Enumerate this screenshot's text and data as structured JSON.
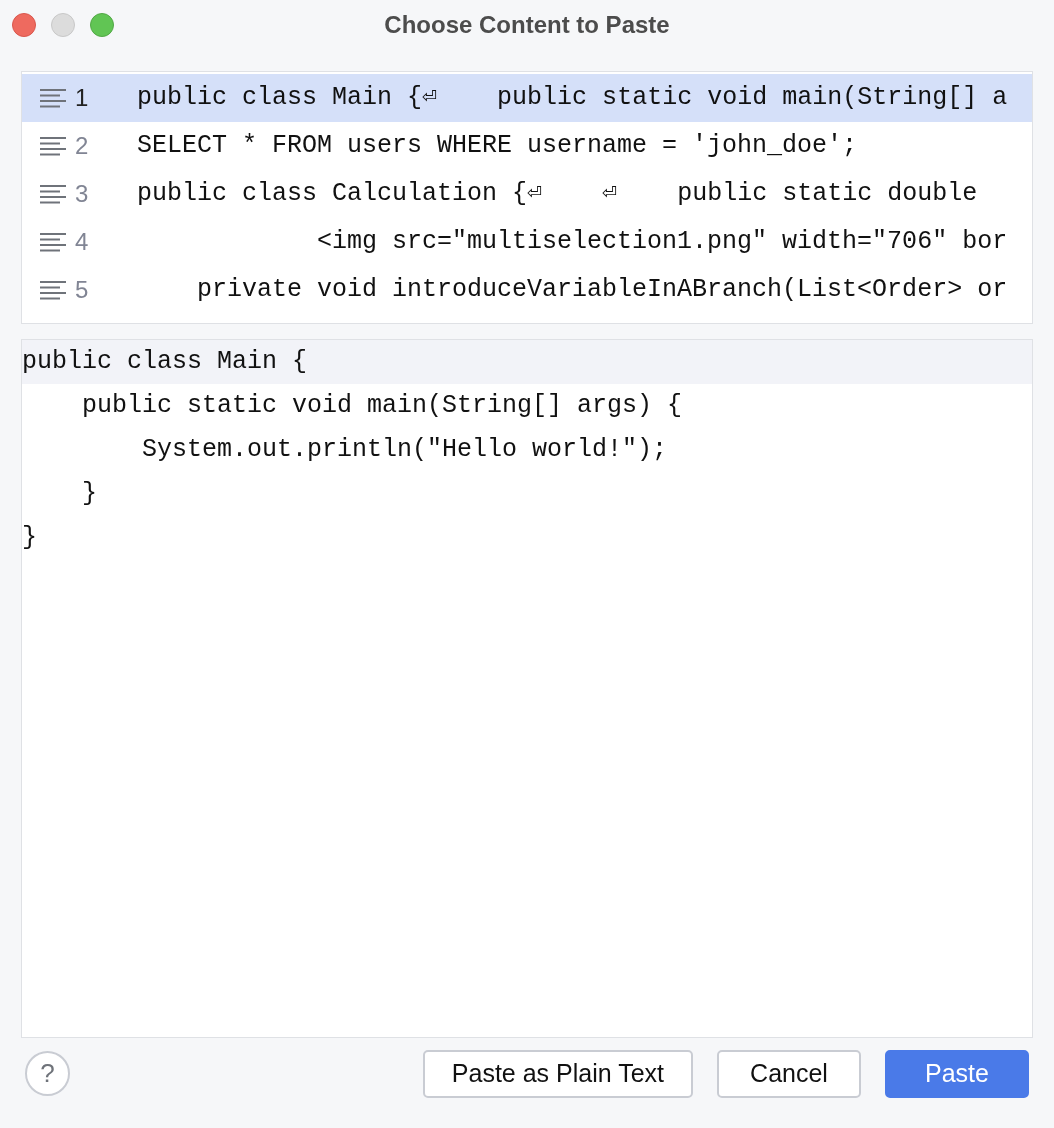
{
  "window": {
    "title": "Choose Content to Paste"
  },
  "clipboard_items": [
    {
      "number": "1",
      "text": "public class Main {⏎    public static void main(String[] a",
      "selected": true
    },
    {
      "number": "2",
      "text": "SELECT * FROM users WHERE username = 'john_doe';",
      "selected": false
    },
    {
      "number": "3",
      "text": "public class Calculation {⏎    ⏎    public static double",
      "selected": false
    },
    {
      "number": "4",
      "text": "            <img src=\"multiselection1.png\" width=\"706\" bor",
      "selected": false
    },
    {
      "number": "5",
      "text": "    private void introduceVariableInABranch(List<Order> or",
      "selected": false
    }
  ],
  "preview": {
    "lines": [
      {
        "text": "public class Main {",
        "current": true
      },
      {
        "text": "    public static void main(String[] args) {",
        "current": false
      },
      {
        "text": "        System.out.println(\"Hello world!\");",
        "current": false
      },
      {
        "text": "    }",
        "current": false
      },
      {
        "text": "}",
        "current": false
      }
    ]
  },
  "help_button": {
    "label": "?"
  },
  "buttons": [
    {
      "label": "Paste as Plain Text",
      "kind": "secondary"
    },
    {
      "label": "Cancel",
      "kind": "secondary"
    },
    {
      "label": "Paste",
      "kind": "primary"
    }
  ]
}
